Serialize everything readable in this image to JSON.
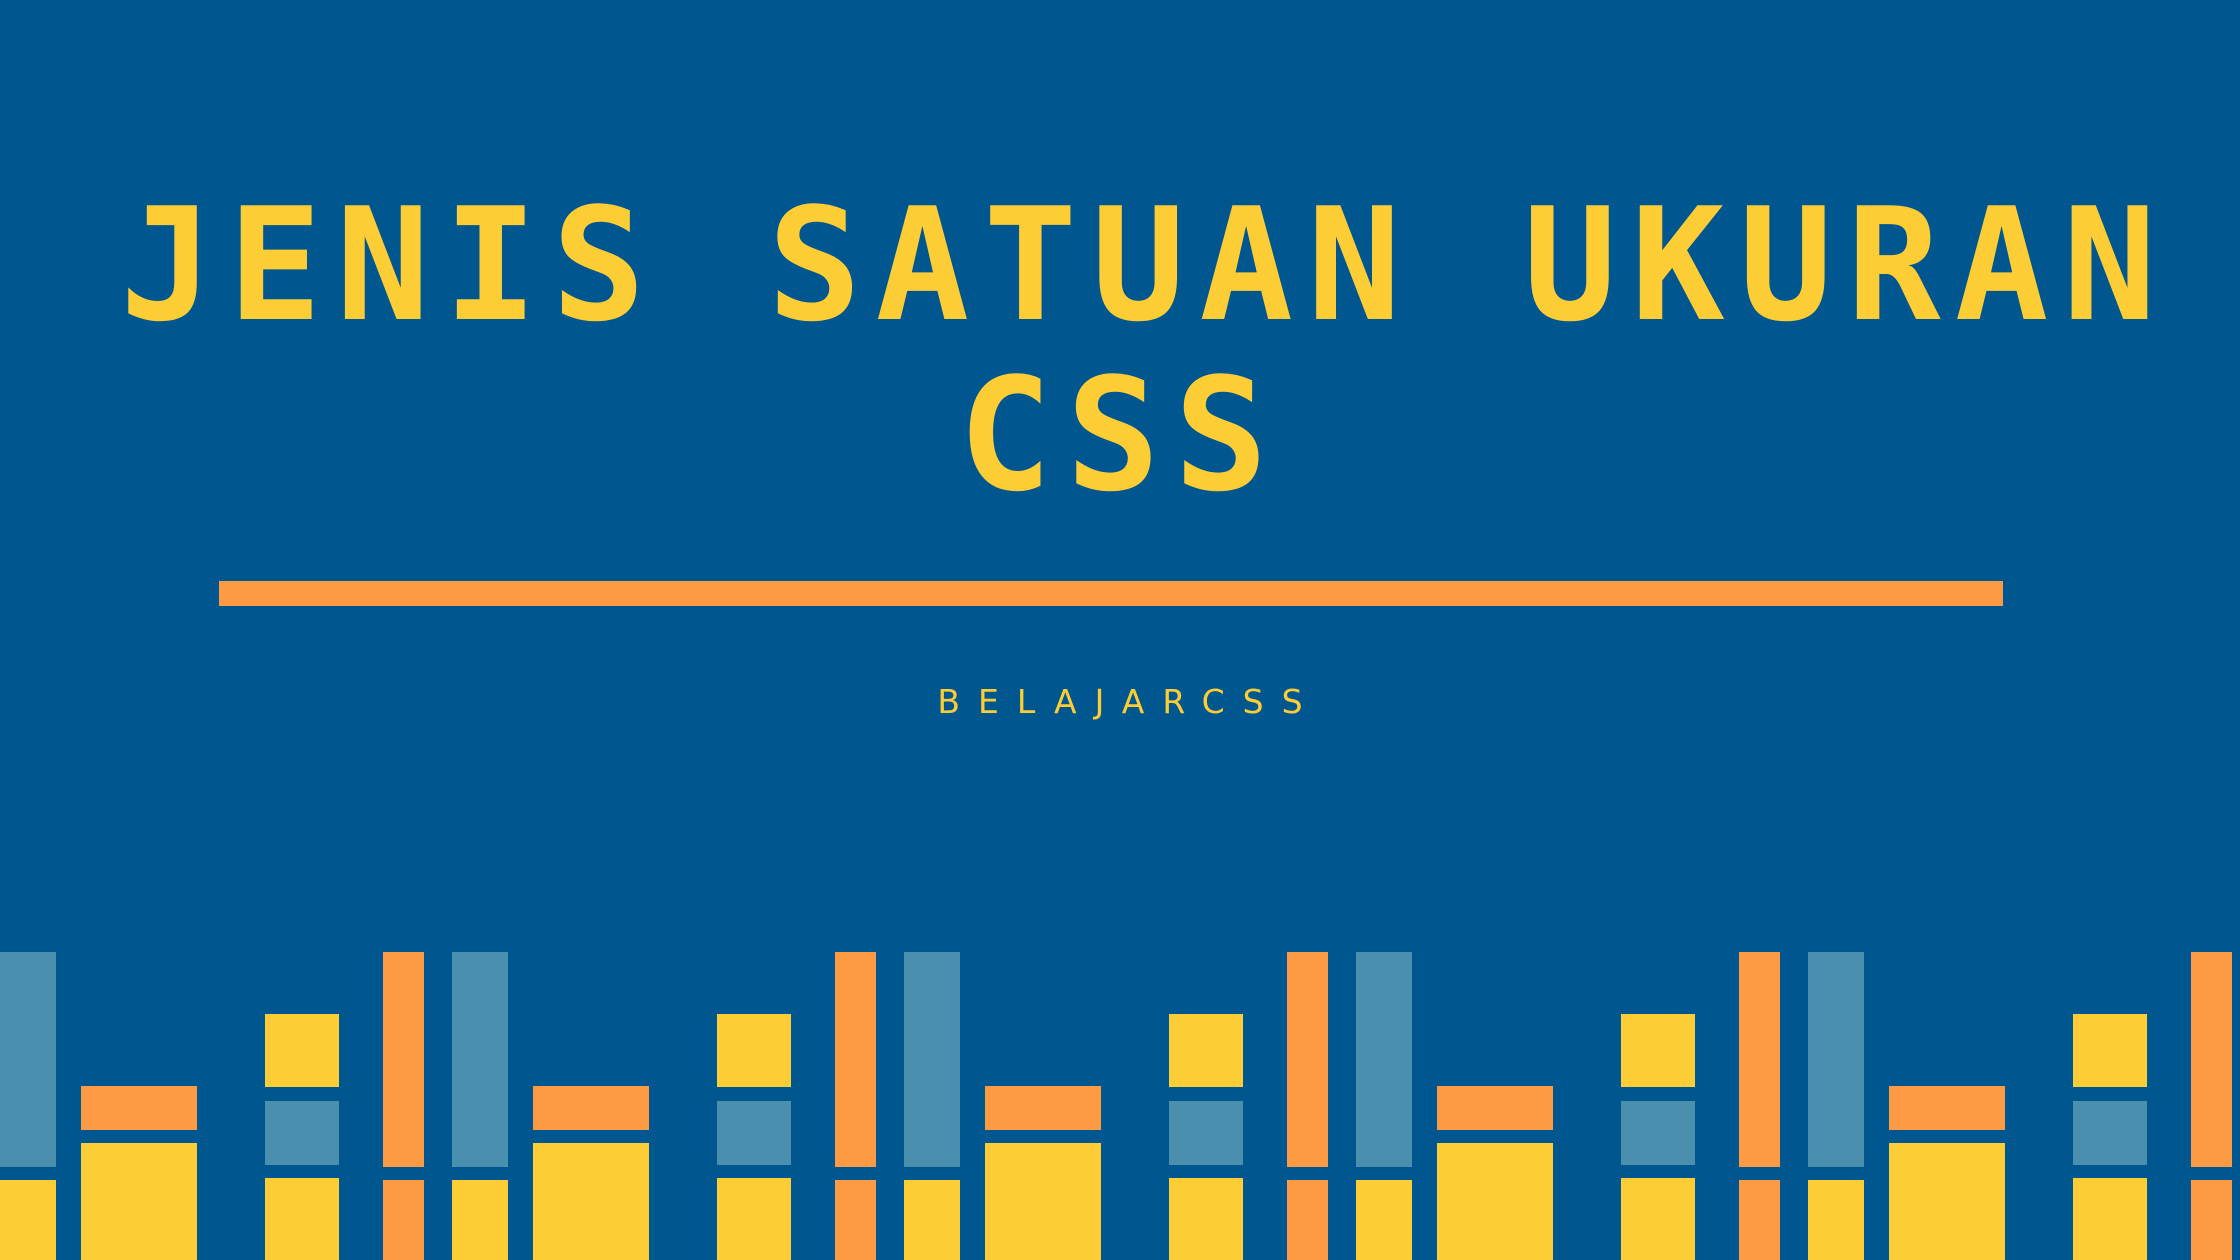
{
  "title": {
    "line1": "JENIS SATUAN UKURAN",
    "line2": "CSS"
  },
  "subtitle": "BELAJARCSS",
  "colors": {
    "background": "#00568e",
    "title": "#fdcd35",
    "subtitle": "#fdcd35",
    "divider": "#fd9a44",
    "bar_yellow": "#fdcd35",
    "bar_orange": "#fd9a44",
    "bar_teal": "#4a8fae"
  },
  "decoration": {
    "name": "bookshelf-pattern",
    "colors": [
      "yellow",
      "orange",
      "teal"
    ]
  }
}
